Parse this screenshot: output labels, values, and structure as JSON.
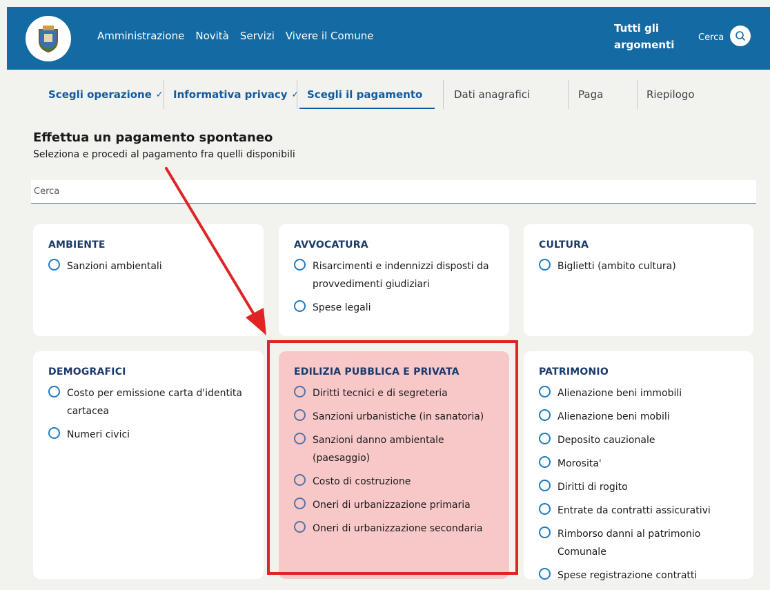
{
  "header": {
    "nav": [
      "Amministrazione",
      "Novità",
      "Servizi",
      "Vivere il Comune"
    ],
    "topics": "Tutti gli argomenti",
    "search_label": "Cerca",
    "logo_icon": "municipal-crest-icon",
    "search_icon": "search-icon",
    "bg_color": "#146aa3"
  },
  "steps": [
    {
      "label": "Scegli operazione",
      "state": "done"
    },
    {
      "label": "Informativa privacy",
      "state": "done"
    },
    {
      "label": "Scegli il pagamento",
      "state": "current"
    },
    {
      "label": "Dati anagrafici",
      "state": "future"
    },
    {
      "label": "Paga",
      "state": "future"
    },
    {
      "label": "Riepilogo",
      "state": "future"
    }
  ],
  "page": {
    "title": "Effettua un pagamento spontaneo",
    "subtitle": "Seleziona e procedi al pagamento fra quelli disponibili"
  },
  "search": {
    "placeholder": "Cerca"
  },
  "categories": [
    {
      "title": "AMBIENTE",
      "items": [
        "Sanzioni ambientali"
      ]
    },
    {
      "title": "AVVOCATURA",
      "items": [
        "Risarcimenti e indennizzi disposti da provvedimenti giudiziari",
        "Spese legali"
      ]
    },
    {
      "title": "CULTURA",
      "items": [
        "Biglietti (ambito cultura)"
      ]
    },
    {
      "title": "DEMOGRAFICI",
      "items": [
        "Costo per emissione carta d'identita cartacea",
        "Numeri civici"
      ]
    },
    {
      "title": "EDILIZIA PUBBLICA E PRIVATA",
      "items": [
        "Diritti tecnici e di segreteria",
        "Sanzioni urbanistiche (in sanatoria)",
        "Sanzioni danno ambientale (paesaggio)",
        "Costo di costruzione",
        "Oneri di urbanizzazione primaria",
        "Oneri di urbanizzazione secondaria"
      ]
    },
    {
      "title": "PATRIMONIO",
      "items": [
        "Alienazione beni immobili",
        "Alienazione beni mobili",
        "Deposito cauzionale",
        "Morosita'",
        "Diritti di rogito",
        "Entrate da contratti assicurativi",
        "Rimborso danni al patrimonio Comunale",
        "Spese registrazione contratti"
      ]
    }
  ],
  "annotation": {
    "color": "#e02424",
    "highlight_fill": "#f8c8c8"
  }
}
